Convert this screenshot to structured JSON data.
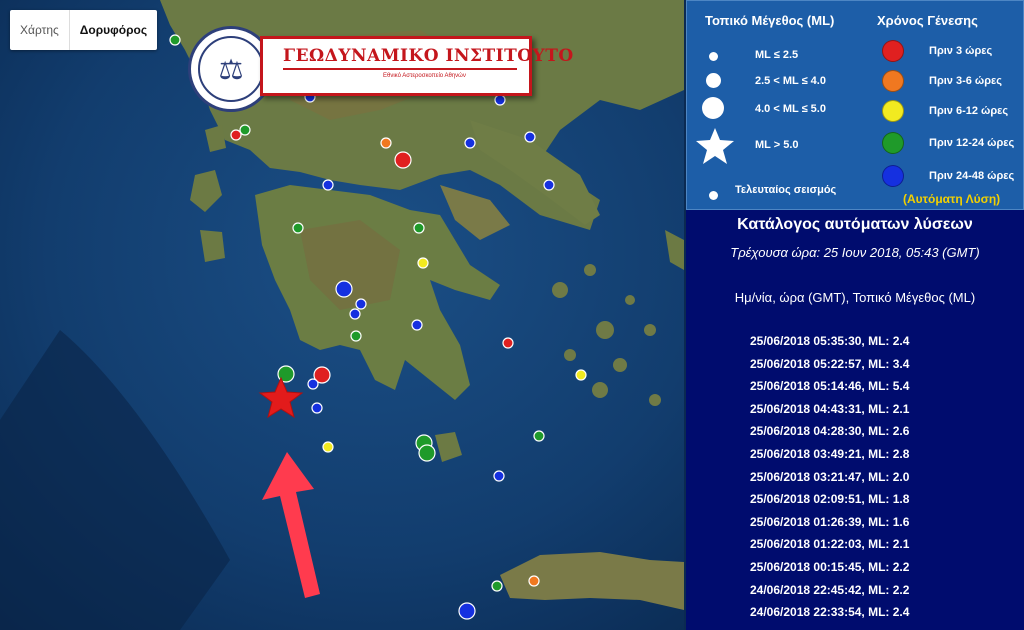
{
  "map_controls": {
    "map_label": "Χάρτης",
    "satellite_label": "Δορυφόρος"
  },
  "logo": {
    "name": "ΓΕΩΔΥΝΑΜΙΚΟ ΙΝΣΤΙΤΟΥΤΟ",
    "subtitle": "Εθνικό Αστεροσκοπείο Αθηνών"
  },
  "legend": {
    "magnitude_title": "Τοπικό Μέγεθος (ML)",
    "age_title": "Χρόνος Γένεσης",
    "magnitudes": [
      "ML ≤ 2.5",
      "2.5 < ML ≤ 4.0",
      "4.0 < ML ≤ 5.0",
      "ML > 5.0"
    ],
    "last_quake": "Τελευταίος σεισμός",
    "ages": [
      {
        "label": "Πριν 3 ώρες",
        "color": "#e02020"
      },
      {
        "label": "Πριν 3-6 ώρες",
        "color": "#f07820"
      },
      {
        "label": "Πριν 6-12 ώρες",
        "color": "#f2ea20"
      },
      {
        "label": "Πριν 12-24 ώρες",
        "color": "#1f9a2a"
      },
      {
        "label": "Πριν 24-48 ώρες",
        "color": "#1530e0"
      }
    ],
    "auto_solution": "(Αυτόματη Λύση)"
  },
  "catalog": {
    "title": "Κατάλογος αυτόματων λύσεων",
    "current_time": "Τρέχουσα ώρα: 25 Ιουν 2018, 05:43 (GMT)",
    "header": "Ημ/νία, ώρα (GMT), Τοπικό Μέγεθος (ML)",
    "rows": [
      "25/06/2018  05:35:30,   ML: 2.4",
      "25/06/2018  05:22:57,   ML: 3.4",
      "25/06/2018  05:14:46,   ML: 5.4",
      "25/06/2018  04:43:31,   ML: 2.1",
      "25/06/2018  04:28:30,   ML: 2.6",
      "25/06/2018  03:49:21,   ML: 2.8",
      "25/06/2018  03:21:47,   ML: 2.0",
      "25/06/2018  02:09:51,   ML: 1.8",
      "25/06/2018  01:26:39,   ML: 1.6",
      "25/06/2018  01:22:03,   ML: 2.1",
      "25/06/2018  00:15:45,   ML: 2.2",
      "24/06/2018  22:45:42,   ML: 2.2",
      "24/06/2018  22:33:54,   ML: 2.4"
    ]
  },
  "colors": {
    "panel_bg": "#000c6e",
    "legend_bg": "#1d5ea8",
    "arrow": "#ff3b4e",
    "star": "#e21b1b"
  }
}
